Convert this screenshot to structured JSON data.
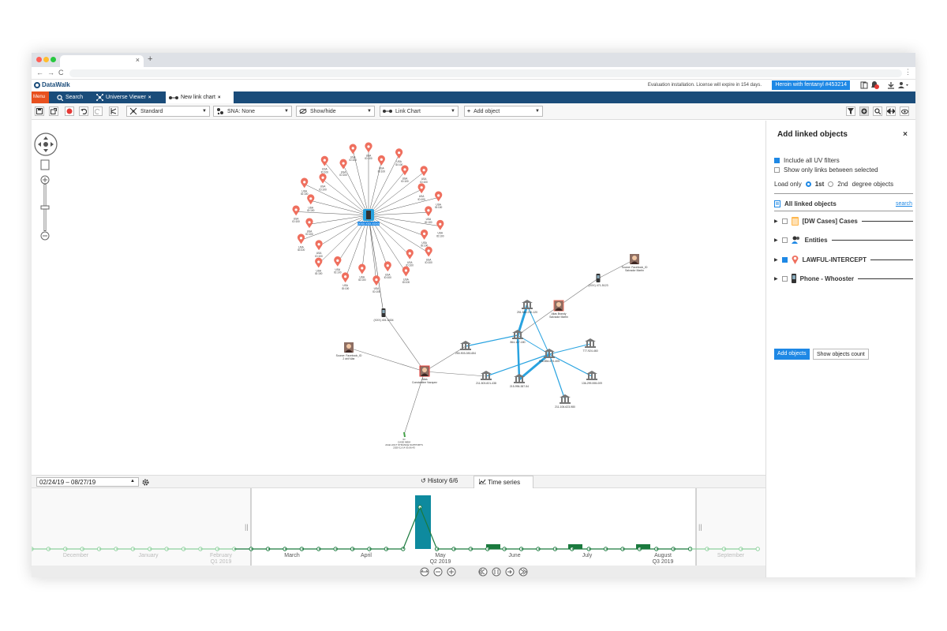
{
  "browser": {
    "tab_close": "×",
    "new_tab": "+",
    "nav_back": "←",
    "nav_forward": "→",
    "nav_reload": "C",
    "kebab": "⋮",
    "dot_colors": [
      "#ff5f57",
      "#ffbd2e",
      "#28c840"
    ]
  },
  "app": {
    "logo": "DataWalk",
    "license": "Evaluation installation. License will expire in 154 days.",
    "case_badge": "Heroin with fentanyl #453214",
    "accent": "#1a4c7a"
  },
  "app_tabs": {
    "menu": "Menu",
    "search": "Search",
    "universe": "Universe Viewer",
    "linkchart": "New link chart",
    "close": "×"
  },
  "toolbar": {
    "layout": "Standard",
    "sna": "SNA: None",
    "showhide": "Show/hide",
    "chart": "Link Chart",
    "add": "Add object"
  },
  "panel": {
    "title": "Add linked objects",
    "close": "×",
    "opt_uv": "Include all UV filters",
    "opt_links": "Show only links between selected",
    "load_only": "Load only",
    "first": "1st",
    "second": "2nd",
    "degree": "degree objects",
    "all_linked": "All linked objects",
    "search": "search",
    "categories": [
      {
        "label": "[DW Cases] Cases",
        "checked": false
      },
      {
        "label": "Entities",
        "checked": false
      },
      {
        "label": "LAWFUL-INTERCEPT",
        "checked": true
      },
      {
        "label": "Phone - Whooster",
        "checked": false
      }
    ],
    "add_btn": "Add objects",
    "count_btn": "Show objects count"
  },
  "timeline": {
    "range": "02/24/19 – 08/27/19",
    "history": "History 6/6",
    "series": "Time series",
    "months": [
      "December",
      "January",
      "February",
      "March",
      "April",
      "May",
      "June",
      "July",
      "August",
      "September"
    ],
    "quarters": [
      "Q1 2019",
      "Q2 2019",
      "Q3 2019"
    ]
  },
  "graph": {
    "hub_label": "(XXX) XXX-XXXX",
    "loc_country": "USA",
    "loc_id": "ID:100",
    "phone1": "(XXX) 401-3434",
    "phone2": "(XXX) 471-5123",
    "person1": "Source: Facebook_ID\n2 drill War",
    "person2": "Source: Facebook_ID\nSalvador Martin",
    "person3": "Alias\nConstantine Vazquez",
    "person4": "Alias Brandy\nSalvador Martin",
    "bank_labels": [
      "250-903-083-654",
      "251-540-230-120",
      "864-117-180",
      "996-854-674-405",
      "777-924-460",
      "211-503-821-438",
      "215-996-387-54",
      "136-299-555-009",
      "211-106-623-980"
    ],
    "report_label": "ID\nCASE MEM\nAGE HOLT STRANGE SUPPORTS\n2020-11-14 03:06:43"
  }
}
